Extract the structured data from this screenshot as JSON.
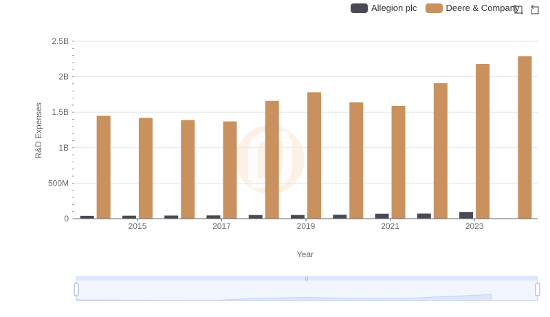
{
  "chart_data": {
    "type": "bar",
    "xlabel": "Year",
    "ylabel": "R&D Expenses",
    "categories": [
      "2014",
      "2015",
      "2016",
      "2017",
      "2018",
      "2019",
      "2020",
      "2021",
      "2022",
      "2023",
      "2024"
    ],
    "x_tick_labels": [
      "2015",
      "2017",
      "2019",
      "2021",
      "2023"
    ],
    "y_ticks": [
      "0",
      "500M",
      "1B",
      "1.5B",
      "2B",
      "2.5B"
    ],
    "ylim": [
      0,
      2500000000
    ],
    "grid": true,
    "legend_position": "top-right",
    "series": [
      {
        "name": "Allegion plc",
        "color": "#4a4a56",
        "values": [
          40000000,
          42000000,
          44000000,
          46000000,
          51000000,
          52000000,
          55000000,
          70000000,
          72000000,
          95000000,
          null
        ]
      },
      {
        "name": "Deere & Company",
        "color": "#c9915e",
        "values": [
          1450000000,
          1420000000,
          1390000000,
          1370000000,
          1660000000,
          1780000000,
          1640000000,
          1590000000,
          1910000000,
          2180000000,
          2290000000
        ]
      }
    ]
  },
  "toolbox": {
    "zoom_icon": "zoom-icon",
    "reset_icon": "restore-icon"
  },
  "colors": {
    "grid": "#e6e6e6",
    "slider_fill": "#dbe6fb",
    "slider_border": "#b8c8ef",
    "watermark": "#f6e3cc"
  }
}
